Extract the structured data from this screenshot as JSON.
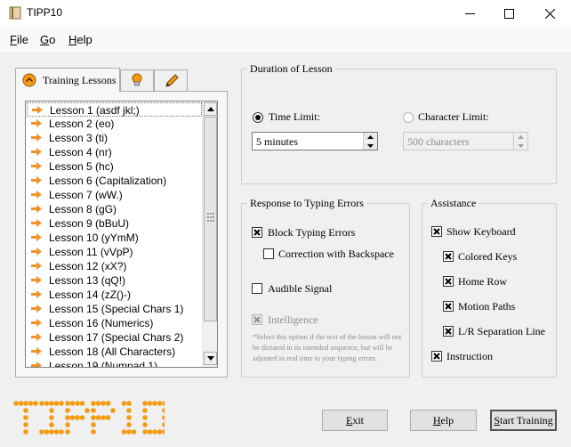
{
  "window": {
    "title": "TIPP10",
    "minimize_icon": "minimize-icon",
    "maximize_icon": "maximize-icon",
    "close_icon": "close-icon"
  },
  "menu": {
    "items": [
      {
        "label": "File",
        "mnemonic": "F",
        "rest": "ile"
      },
      {
        "label": "Go",
        "mnemonic": "G",
        "rest": "o"
      },
      {
        "label": "Help",
        "mnemonic": "H",
        "rest": "elp"
      }
    ]
  },
  "tabs": [
    {
      "label": "Training Lessons",
      "icon": "lessons-icon",
      "active": true
    },
    {
      "label": "",
      "icon": "lightbulb-icon",
      "active": false
    },
    {
      "label": "",
      "icon": "pencil-icon",
      "active": false
    }
  ],
  "lessons": [
    "Lesson 1 (asdf jkl;)",
    "Lesson 2 (eo)",
    "Lesson 3 (ti)",
    "Lesson 4 (nr)",
    "Lesson 5 (hc)",
    "Lesson 6 (Capitalization)",
    "Lesson 7 (wW.)",
    "Lesson 8 (gG)",
    "Lesson 9 (bBuU)",
    "Lesson 10 (yYmM)",
    "Lesson 11 (vVpP)",
    "Lesson 12 (xX?)",
    "Lesson 13 (qQ!)",
    "Lesson 14 (zZ()-)",
    "Lesson 15 (Special Chars 1)",
    "Lesson 16 (Numerics)",
    "Lesson 17 (Special Chars 2)",
    "Lesson 18 (All Characters)",
    "Lesson 19 (Numpad 1)"
  ],
  "duration": {
    "title": "Duration of Lesson",
    "time_limit_label": "Time Limit:",
    "time_limit_value": "5 minutes",
    "char_limit_label": "Character Limit:",
    "char_limit_value": "500 characters"
  },
  "errors": {
    "title": "Response to Typing Errors",
    "block_label": "Block Typing Errors",
    "correction_label": "Correction with Backspace",
    "audible_label": "Audible Signal",
    "intelligence_label": "Intelligence",
    "note": "*Select this option if the text of the lesson will not be dictated in its intended sequence, but will be adjusted in real time to your typing errors."
  },
  "assistance": {
    "title": "Assistance",
    "show_keyboard": "Show Keyboard",
    "colored_keys": "Colored Keys",
    "home_row": "Home Row",
    "motion_paths": "Motion Paths",
    "separation_line": "L/R Separation Line",
    "instruction": "Instruction"
  },
  "buttons": {
    "exit": {
      "label": "Exit",
      "mnemonic": "E",
      "rest": "xit"
    },
    "help": {
      "label": "Help",
      "mnemonic": "H",
      "rest": "elp"
    },
    "start": {
      "label": "Start Training",
      "mnemonic": "S",
      "rest": "tart Training"
    }
  },
  "logo_text": "TIPP10",
  "colors": {
    "accent": "#f39c12",
    "arrow": "#f0932b"
  }
}
